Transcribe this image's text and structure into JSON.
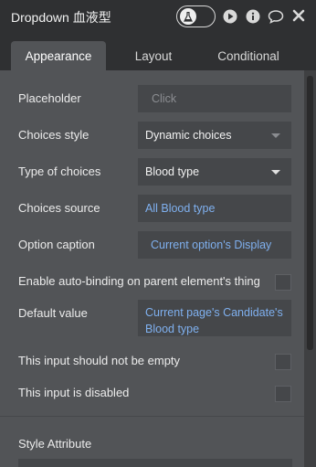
{
  "window": {
    "title": "Dropdown 血液型",
    "icons": [
      "preview-toggle",
      "play-icon",
      "info-icon",
      "comment-icon",
      "close-icon"
    ]
  },
  "tabs": [
    {
      "label": "Appearance",
      "active": true
    },
    {
      "label": "Layout",
      "active": false
    },
    {
      "label": "Conditional",
      "active": false
    }
  ],
  "properties": {
    "placeholder": {
      "label": "Placeholder",
      "placeholder": "Click",
      "value": ""
    },
    "choices_style": {
      "label": "Choices style",
      "value": "Dynamic choices"
    },
    "type_of_choices": {
      "label": "Type of choices",
      "value": "Blood type"
    },
    "choices_source": {
      "label": "Choices source",
      "value": "All Blood type"
    },
    "option_caption": {
      "label": "Option caption",
      "value": "Current option's Display"
    },
    "auto_binding": {
      "label": "Enable auto-binding on parent element's thing",
      "checked": false
    },
    "default_value": {
      "label": "Default value",
      "value": "Current page's Candidate's Blood type"
    },
    "not_empty": {
      "label": "This input should not be empty",
      "checked": false
    },
    "disabled": {
      "label": "This input is disabled",
      "checked": false
    }
  },
  "style_section": {
    "label": "Style Attribute"
  },
  "colors": {
    "panel_bg": "#525457",
    "header_bg": "#2f3032",
    "field_bg": "#45474a",
    "dynamic_text": "#7fb0ef"
  }
}
